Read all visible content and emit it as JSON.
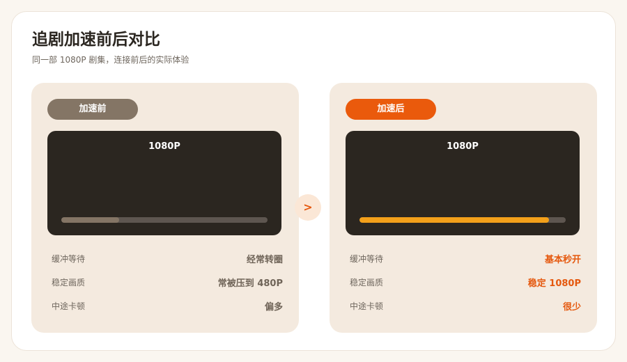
{
  "header": {
    "title": "追剧加速前后对比",
    "subtitle": "同一部  1080P 剧集，连接前后的实际体验"
  },
  "before": {
    "badge": "加速前",
    "resolution": "1080P",
    "progress": 0.28,
    "rows": [
      {
        "label": "缓冲等待",
        "value": "经常转圈"
      },
      {
        "label": "稳定画质",
        "value": "常被压到 480P"
      },
      {
        "label": "中途卡顿",
        "value": "偏多"
      }
    ]
  },
  "after": {
    "badge": "加速后",
    "resolution": "1080P",
    "progress": 0.92,
    "rows": [
      {
        "label": "缓冲等待",
        "value": "基本秒开"
      },
      {
        "label": "稳定画质",
        "value": "稳定 1080P"
      },
      {
        "label": "中途卡顿",
        "value": "很少"
      }
    ]
  },
  "arrow": {
    "glyph": ">"
  },
  "colors": {
    "accent": "#ea5a0c",
    "before_badge": "#847565",
    "after_progress": "#f3a01a",
    "panel_bg": "#f4eadf",
    "screen_bg": "#2b2620"
  }
}
